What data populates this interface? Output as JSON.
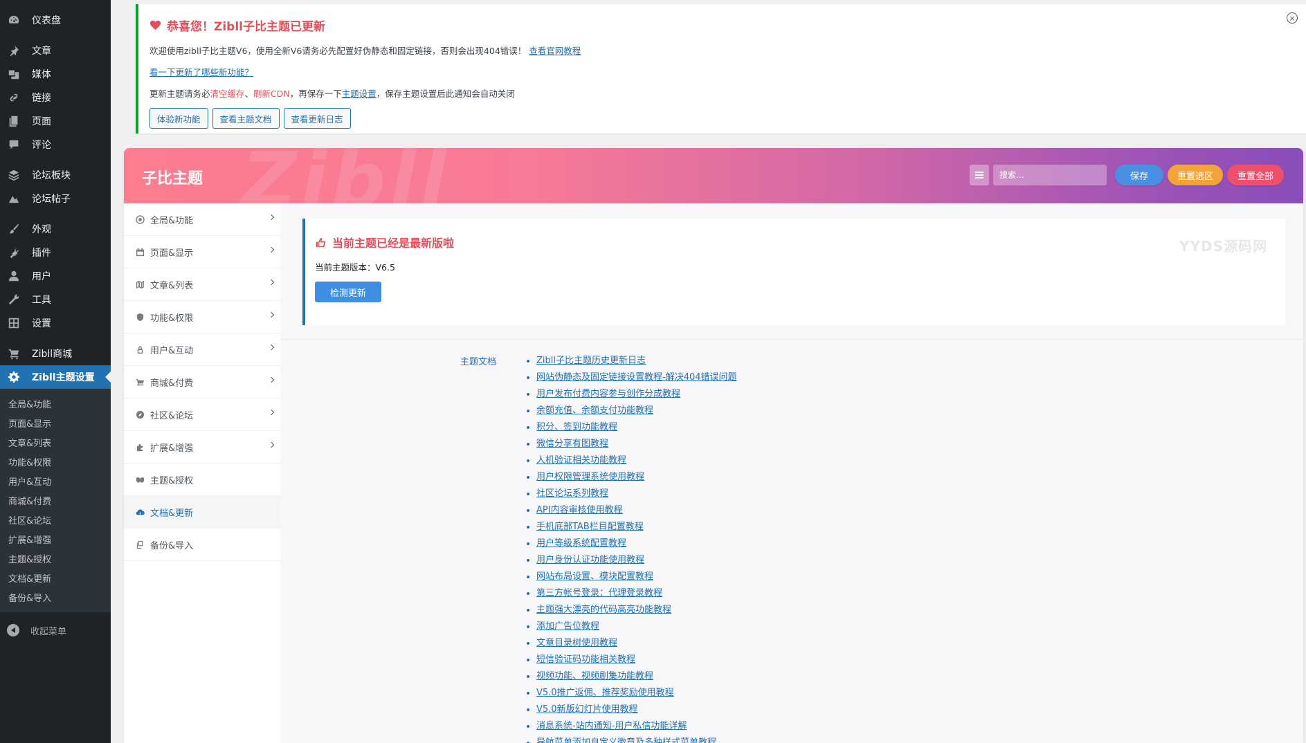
{
  "sidebar": {
    "dashboard": "仪表盘",
    "posts": "文章",
    "media": "媒体",
    "links": "链接",
    "pages": "页面",
    "comments": "评论",
    "forum_boards": "论坛板块",
    "forum_posts": "论坛帖子",
    "appearance": "外观",
    "plugins": "插件",
    "users": "用户",
    "tools": "工具",
    "settings": "设置",
    "shop": "Zibll商城",
    "theme_settings": "Zibll主题设置",
    "submenu": [
      "全局&功能",
      "页面&显示",
      "文章&列表",
      "功能&权限",
      "用户&互动",
      "商城&付费",
      "社区&论坛",
      "扩展&增强",
      "主题&授权",
      "文档&更新",
      "备份&导入"
    ],
    "collapse": "收起菜单"
  },
  "notice": {
    "title": "恭喜您！Zibll子比主题已更新",
    "line1": "欢迎使用zibll子比主题V6，使用全新V6请务必先配置好伪静态和固定链接，否则会出现404错误！",
    "line1_link": "查看官网教程",
    "line2_link": "看一下更新了哪些新功能？",
    "line3_a": "更新主题请务必",
    "line3_b": "清空缓存",
    "line3_c": "、",
    "line3_d": "刷新CDN",
    "line3_e": "，再保存一下",
    "line3_f": "主题设置",
    "line3_g": "，保存主题设置后此通知会自动关闭",
    "buttons": [
      "体验新功能",
      "查看主题文档",
      "查看更新日志"
    ],
    "close": "×",
    "accent": "#00a32a"
  },
  "panel": {
    "title": "子比主题",
    "watermark": "Zibll",
    "search_placeholder": "搜索...",
    "save": "保存",
    "reset_section": "重置选区",
    "reset_all": "重置全部",
    "nav": [
      {
        "label": "全局&功能",
        "icon": "globe-icon"
      },
      {
        "label": "页面&显示",
        "icon": "calendar-icon"
      },
      {
        "label": "文章&列表",
        "icon": "map-icon"
      },
      {
        "label": "功能&权限",
        "icon": "shield-icon"
      },
      {
        "label": "用户&互动",
        "icon": "lock-icon"
      },
      {
        "label": "商城&付费",
        "icon": "cart-icon"
      },
      {
        "label": "社区&论坛",
        "icon": "compass-icon"
      },
      {
        "label": "扩展&增强",
        "icon": "puzzle-icon"
      },
      {
        "label": "主题&授权",
        "icon": "handshake-icon"
      },
      {
        "label": "文档&更新",
        "icon": "cloud-download-icon"
      },
      {
        "label": "备份&导入",
        "icon": "copy-icon"
      }
    ],
    "active_nav": "文档&更新"
  },
  "update": {
    "title": "当前主题已经是最新版啦",
    "version_label": "当前主题版本：V6.5",
    "check_button": "检测更新",
    "site_watermark": "YYDS源码网"
  },
  "docs": {
    "label": "主题文档",
    "items": [
      "Zibll子比主题历史更新日志",
      "网站伪静态及固定链接设置教程-解决404错误问题",
      "用户发布付费内容参与创作分成教程",
      "余额充值、余额支付功能教程",
      "积分、签到功能教程",
      "微信分享有图教程",
      "人机验证相关功能教程",
      "用户权限管理系统使用教程",
      "社区论坛系列教程",
      "API内容审核使用教程",
      "手机底部TAB栏目配置教程",
      "用户等级系统配置教程",
      "用户身份认证功能使用教程",
      "网站布局设置、模块配置教程",
      "第三方帐号登录：代理登录教程",
      "主题强大漂亮的代码高亮功能教程",
      "添加广告位教程",
      "文章目录树使用教程",
      "短信验证码功能相关教程",
      "视频功能、视频剧集功能教程",
      "V5.0推广返佣、推荐奖励使用教程",
      "V5.0新版幻灯片使用教程",
      "消息系统-站内通知-用户私信功能详解",
      "导航菜单添加自定义徽章及多种样式菜单教程"
    ]
  }
}
